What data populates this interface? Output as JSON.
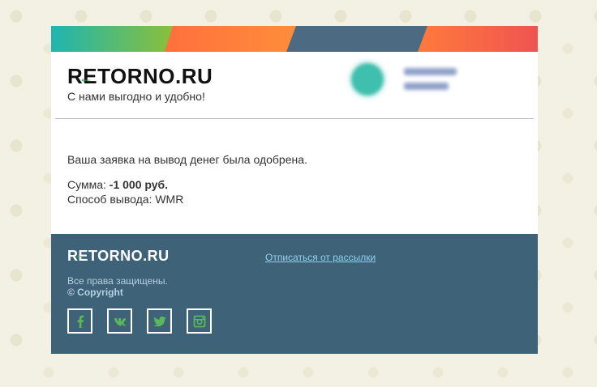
{
  "header": {
    "logo_text": "RETORNO.RU",
    "tagline": "С нами выгодно и удобно!"
  },
  "message": {
    "approved": "Ваша заявка на вывод денег была одобрена.",
    "amount_label": "Сумма: ",
    "amount_value": "-1 000 руб.",
    "method_label": "Способ вывода: ",
    "method_value": "WMR"
  },
  "footer": {
    "logo_text": "RETORNO.RU",
    "unsubscribe": "Отписаться от рассылки",
    "rights": "Все права защищены.",
    "copyright": "© Copyright",
    "socials": [
      "facebook",
      "vk",
      "twitter",
      "instagram"
    ]
  },
  "colors": {
    "footer_bg": "#3e6277",
    "social_icon": "#58b85a",
    "link": "#8fd0f0"
  }
}
